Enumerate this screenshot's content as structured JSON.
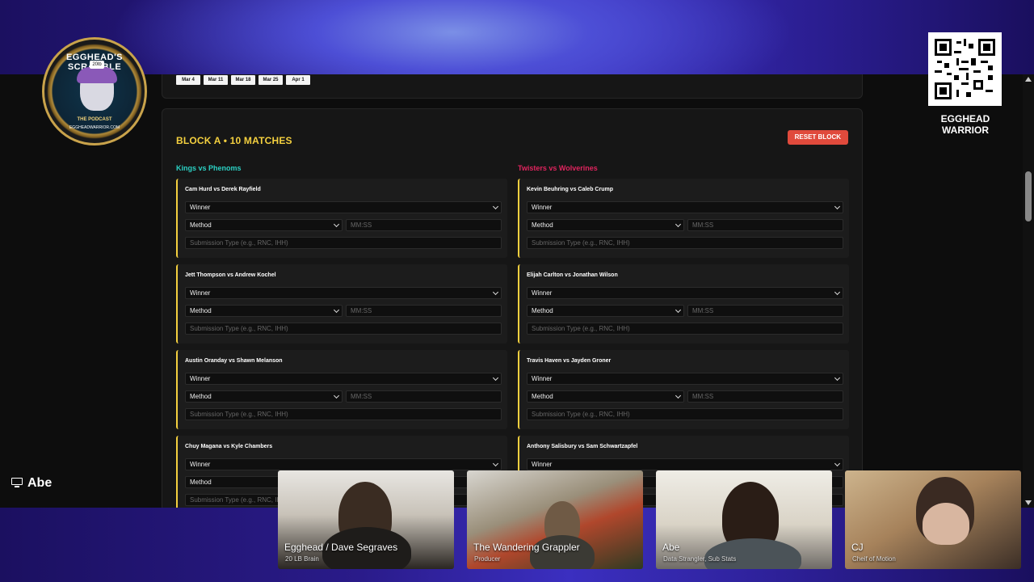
{
  "weeks": [
    {
      "label": "Mar 4"
    },
    {
      "label": "Mar 11"
    },
    {
      "label": "Mar 18"
    },
    {
      "label": "Mar 25"
    },
    {
      "label": "Apr 1"
    }
  ],
  "block": {
    "title": "BLOCK A • 10 MATCHES",
    "reset_label": "RESET BLOCK",
    "left_team": "Kings vs Phenoms",
    "right_team": "Twisters vs Wolverines"
  },
  "form": {
    "winner_label": "Winner",
    "method_label": "Method",
    "time_placeholder": "MM:SS",
    "submission_placeholder": "Submission Type (e.g., RNC, IHH)"
  },
  "left_matches": [
    {
      "title": "Cam Hurd vs Derek Rayfield"
    },
    {
      "title": "Jett Thompson vs Andrew Kochel"
    },
    {
      "title": "Austin Oranday vs Shawn Melanson"
    },
    {
      "title": "Chuy Magana vs Kyle Chambers"
    }
  ],
  "right_matches": [
    {
      "title": "Kevin Beuhring vs Caleb Crump"
    },
    {
      "title": "Elijah Carlton vs Jonathan Wilson"
    },
    {
      "title": "Travis Haven vs Jayden Groner"
    },
    {
      "title": "Anthony Salisbury vs Sam Schwartzapfel"
    }
  ],
  "overlay": {
    "logo_title": "EGGHEAD'S SCRAMBLE",
    "logo_badge": "20lb",
    "logo_sub": "THE PODCAST",
    "logo_url": "EGGHEADWARRIOR.COM",
    "qr_caption_line1": "EGGHEAD",
    "qr_caption_line2": "WARRIOR",
    "share_name": "Abe"
  },
  "participants": [
    {
      "name": "Egghead / Dave Segraves",
      "role": "20 LB Brain"
    },
    {
      "name": "The Wandering Grappler",
      "role": "Producer"
    },
    {
      "name": "Abe",
      "role": "Data Strangler, Sub Stats"
    },
    {
      "name": "CJ",
      "role": "Cheif of Motion"
    }
  ],
  "icons": {
    "share": "monitor-icon",
    "select": "chevron-down-icon"
  },
  "colors": {
    "accent_yellow": "#f4d03f",
    "left_team": "#2bd1c4",
    "right_team": "#e0245e",
    "reset_button": "#e04a3c"
  }
}
